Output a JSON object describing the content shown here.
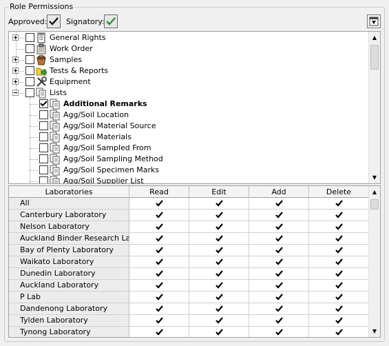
{
  "group_title": "Role Permissions",
  "flags": {
    "approved": {
      "label": "Approved:",
      "checked": true
    },
    "signatory": {
      "label": "Signatory:",
      "checked": true
    }
  },
  "tree": {
    "items": [
      {
        "label": "General Rights",
        "icon": "notepad-icon",
        "expander": "plus",
        "checked": false,
        "level": 0
      },
      {
        "label": "Work Order",
        "icon": "clipboard-icon",
        "expander": "none",
        "checked": false,
        "level": 0
      },
      {
        "label": "Samples",
        "icon": "bucket-icon",
        "expander": "plus",
        "checked": false,
        "level": 0
      },
      {
        "label": "Tests & Reports",
        "icon": "folder-arrow-icon",
        "expander": "plus",
        "checked": false,
        "level": 0
      },
      {
        "label": "Equipment",
        "icon": "tools-icon",
        "expander": "plus",
        "checked": false,
        "level": 0
      },
      {
        "label": "Lists",
        "icon": "documents-icon",
        "expander": "minus",
        "checked": false,
        "level": 0
      },
      {
        "label": "Additional Remarks",
        "icon": "documents-icon",
        "expander": "none",
        "checked": true,
        "level": 1,
        "bold": true
      },
      {
        "label": "Agg/Soil Location",
        "icon": "documents-icon",
        "expander": "none",
        "checked": false,
        "level": 1
      },
      {
        "label": "Agg/Soil Material Source",
        "icon": "documents-icon",
        "expander": "none",
        "checked": false,
        "level": 1
      },
      {
        "label": "Agg/Soil Materials",
        "icon": "documents-icon",
        "expander": "none",
        "checked": false,
        "level": 1
      },
      {
        "label": "Agg/Soil Sampled From",
        "icon": "documents-icon",
        "expander": "none",
        "checked": false,
        "level": 1
      },
      {
        "label": "Agg/Soil Sampling Method",
        "icon": "documents-icon",
        "expander": "none",
        "checked": false,
        "level": 1
      },
      {
        "label": "Agg/Soil Specimen Marks",
        "icon": "documents-icon",
        "expander": "none",
        "checked": false,
        "level": 1
      },
      {
        "label": "Agg/Soil Supplier List",
        "icon": "documents-icon",
        "expander": "none",
        "checked": false,
        "level": 1
      }
    ]
  },
  "grid": {
    "columns": [
      "Laboratories",
      "Read",
      "Edit",
      "Add",
      "Delete"
    ],
    "rows": [
      {
        "name": "All",
        "read": true,
        "edit": true,
        "add": true,
        "delete": true
      },
      {
        "name": "Canterbury Laboratory",
        "read": true,
        "edit": true,
        "add": true,
        "delete": true
      },
      {
        "name": "Nelson Laboratory",
        "read": true,
        "edit": true,
        "add": true,
        "delete": true
      },
      {
        "name": "Auckland Binder Research Labo",
        "read": true,
        "edit": true,
        "add": true,
        "delete": true
      },
      {
        "name": "Bay of Plenty Laboratory",
        "read": true,
        "edit": true,
        "add": true,
        "delete": true
      },
      {
        "name": "Waikato Laboratory",
        "read": true,
        "edit": true,
        "add": true,
        "delete": true
      },
      {
        "name": "Dunedin Laboratory",
        "read": true,
        "edit": true,
        "add": true,
        "delete": true
      },
      {
        "name": "Auckland Laboratory",
        "read": true,
        "edit": true,
        "add": true,
        "delete": true
      },
      {
        "name": "P Lab",
        "read": true,
        "edit": true,
        "add": true,
        "delete": true
      },
      {
        "name": "Dandenong Laboratory",
        "read": true,
        "edit": true,
        "add": true,
        "delete": true
      },
      {
        "name": "Tylden Laboratory",
        "read": true,
        "edit": true,
        "add": true,
        "delete": true
      },
      {
        "name": "Tynong Laboratory",
        "read": true,
        "edit": true,
        "add": true,
        "delete": true
      }
    ]
  },
  "colors": {
    "accent_check": "#2f8a2f",
    "tree_bg": "#ffffff",
    "header_bg": "#f4f4f4"
  }
}
